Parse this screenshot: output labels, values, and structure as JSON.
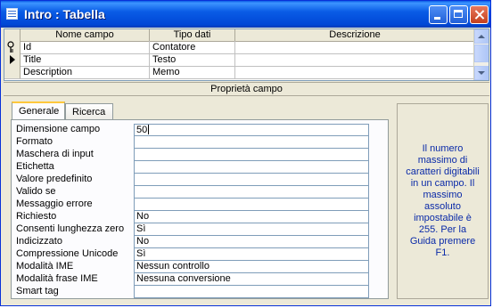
{
  "window": {
    "title": "Intro : Tabella"
  },
  "grid": {
    "headers": [
      "Nome campo",
      "Tipo dati",
      "Descrizione"
    ],
    "rows": [
      {
        "name": "Id",
        "type": "Contatore",
        "desc": ""
      },
      {
        "name": "Title",
        "type": "Testo",
        "desc": ""
      },
      {
        "name": "Description",
        "type": "Memo",
        "desc": ""
      }
    ]
  },
  "properties_header": "Proprietà campo",
  "tabs": [
    "Generale",
    "Ricerca"
  ],
  "properties": [
    {
      "label": "Dimensione campo",
      "value": "50"
    },
    {
      "label": "Formato",
      "value": ""
    },
    {
      "label": "Maschera di input",
      "value": ""
    },
    {
      "label": "Etichetta",
      "value": ""
    },
    {
      "label": "Valore predefinito",
      "value": ""
    },
    {
      "label": "Valido se",
      "value": ""
    },
    {
      "label": "Messaggio errore",
      "value": ""
    },
    {
      "label": "Richiesto",
      "value": "No"
    },
    {
      "label": "Consenti lunghezza zero",
      "value": "Sì"
    },
    {
      "label": "Indicizzato",
      "value": "No"
    },
    {
      "label": "Compressione Unicode",
      "value": "Sì"
    },
    {
      "label": "Modalità IME",
      "value": "Nessun controllo"
    },
    {
      "label": "Modalità frase IME",
      "value": "Nessuna conversione"
    },
    {
      "label": "Smart tag",
      "value": ""
    }
  ],
  "help_text": "Il numero massimo di caratteri digitabili in un campo. Il massimo assoluto impostabile è 255. Per la Guida premere F1."
}
